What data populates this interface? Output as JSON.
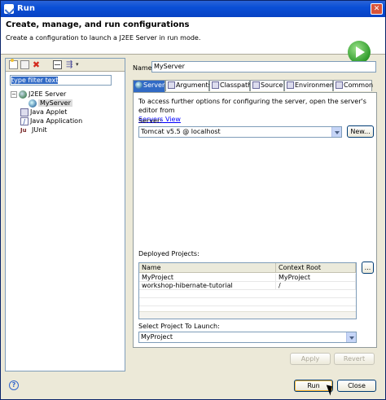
{
  "window": {
    "title": "Run",
    "app_icon": "eclipse-icon",
    "close_glyph": "✕"
  },
  "banner": {
    "heading": "Create, manage, and run configurations",
    "description": "Create a configuration to launch a J2EE Server in run mode.",
    "icon": "run-icon"
  },
  "left": {
    "toolbar": {
      "new_icon": "new-config-icon",
      "duplicate_icon": "duplicate-icon",
      "delete_glyph": "✖",
      "collapse_icon": "collapse-all-icon",
      "filter_glyph": "⇶",
      "menu_glyph": "▾"
    },
    "filter_text": "type filter text",
    "tree": [
      {
        "label": "J2EE Server",
        "icon": "globe-icon",
        "expanded": true,
        "toggle": "−"
      },
      {
        "label": "MyServer",
        "icon": "server-icon",
        "selected": true
      },
      {
        "label": "Java Applet",
        "icon": "applet-icon"
      },
      {
        "label": "Java Application",
        "icon": "java-app-icon",
        "glyph": "J"
      },
      {
        "label": "JUnit",
        "icon": "junit-icon",
        "glyph": "Ju"
      }
    ]
  },
  "right": {
    "name_label": "Name:",
    "name_value": "MyServer",
    "tabs": [
      {
        "label": "Server",
        "icon": "server-tab-icon",
        "active": true
      },
      {
        "label": "Arguments",
        "icon": "arguments-icon"
      },
      {
        "label": "Classpath",
        "icon": "classpath-icon"
      },
      {
        "label": "Source",
        "icon": "source-icon"
      },
      {
        "label": "Environment",
        "icon": "environment-icon"
      },
      {
        "label": "Common",
        "icon": "common-icon"
      }
    ],
    "server_tab": {
      "info": "To access further options for configuring the server, open the server's editor from",
      "info_link": "Servers View",
      "server_label": "Server:",
      "server_selected": "Tomcat v5.5 @ localhost",
      "new_button": "New...",
      "deployed_label": "Deployed Projects:",
      "columns": [
        "Name",
        "Context Root"
      ],
      "rows": [
        [
          "MyProject",
          "MyProject"
        ],
        [
          "workshop-hibernate-tutorial",
          "/"
        ]
      ],
      "browse_button": "...",
      "select_label": "Select Project To Launch:",
      "project_selected": "MyProject"
    },
    "apply_button": "Apply",
    "revert_button": "Revert"
  },
  "footer": {
    "help_glyph": "?",
    "run_button": "Run",
    "close_button": "Close"
  },
  "colors": {
    "title_bar": "#0a4fd6",
    "selection": "#316ac5",
    "dialog_bg": "#ece9d8"
  }
}
